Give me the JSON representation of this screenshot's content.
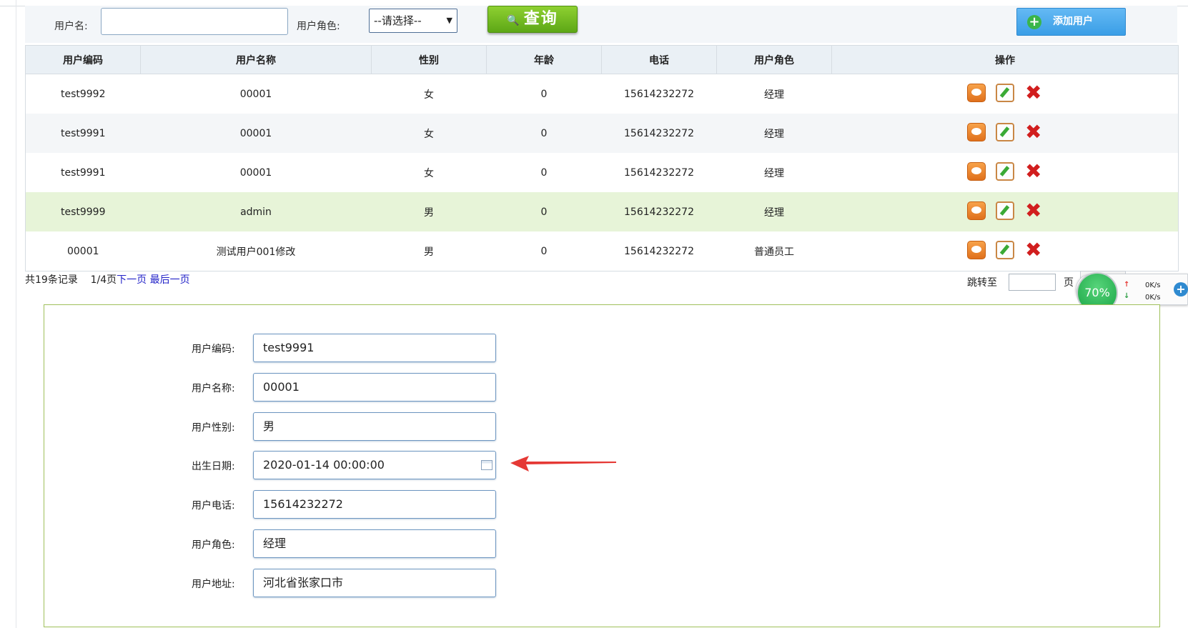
{
  "search": {
    "username_label": "用户名:",
    "username_value": "",
    "role_label": "用户角色:",
    "role_selected": "--请选择--",
    "query_label": "查询",
    "add_user_label": "添加用户"
  },
  "table": {
    "headers": [
      "用户编码",
      "用户名称",
      "性别",
      "年龄",
      "电话",
      "用户角色",
      "操作"
    ],
    "rows": [
      {
        "code": "test9992",
        "name": "00001",
        "gender": "女",
        "age": "0",
        "phone": "15614232272",
        "role": "经理"
      },
      {
        "code": "test9991",
        "name": "00001",
        "gender": "女",
        "age": "0",
        "phone": "15614232272",
        "role": "经理"
      },
      {
        "code": "test9991",
        "name": "00001",
        "gender": "女",
        "age": "0",
        "phone": "15614232272",
        "role": "经理"
      },
      {
        "code": "test9999",
        "name": "admin",
        "gender": "男",
        "age": "0",
        "phone": "15614232272",
        "role": "经理"
      },
      {
        "code": "00001",
        "name": "测试用户001修改",
        "gender": "男",
        "age": "0",
        "phone": "15614232272",
        "role": "普通员工"
      }
    ]
  },
  "pager": {
    "total": "共19条记录",
    "page": "1/4页",
    "next": "下一页",
    "last": "最后一页",
    "jump_label": "跳转至",
    "jump_unit": "页"
  },
  "widget": {
    "percent": "70%",
    "up_speed": "0K/s",
    "down_speed": "0K/s"
  },
  "detail": {
    "fields": [
      {
        "label": "用户编码:",
        "value": "test9991"
      },
      {
        "label": "用户名称:",
        "value": "00001"
      },
      {
        "label": "用户性别:",
        "value": "男"
      },
      {
        "label": "出生日期:",
        "value": "2020-01-14 00:00:00"
      },
      {
        "label": "用户电话:",
        "value": "15614232272"
      },
      {
        "label": "用户角色:",
        "value": "经理"
      },
      {
        "label": "用户地址:",
        "value": "河北省张家口市"
      }
    ]
  },
  "colors": {
    "query_button": "#6cb820",
    "add_button": "#4aa8ea",
    "highlight_row": "#e7f4d8",
    "annotation_arrow": "#e53935",
    "link": "#2323c8"
  }
}
